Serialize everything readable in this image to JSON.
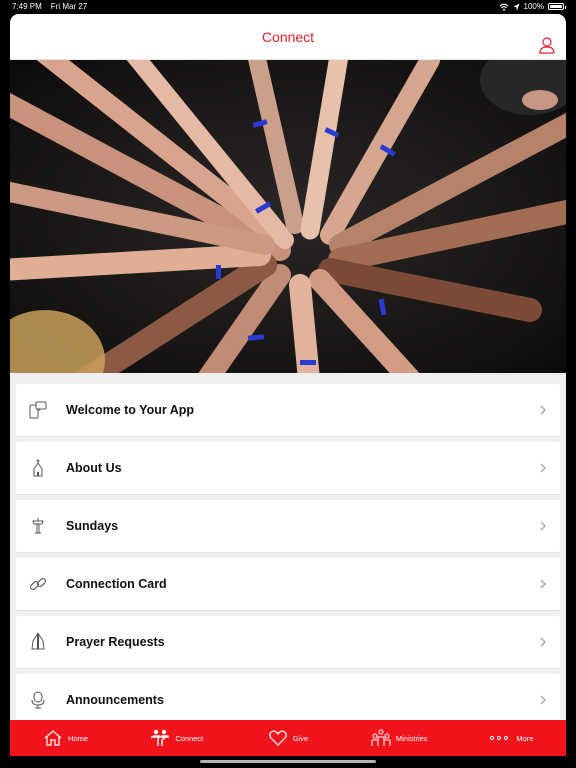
{
  "status": {
    "time": "7:49 PM",
    "date": "Fri Mar 27",
    "battery": "100%",
    "battery_level": 1.0
  },
  "header": {
    "title": "Connect",
    "profile_icon": "person-icon"
  },
  "hero": {
    "description_icon": "hands-together-photo"
  },
  "menu": [
    {
      "label": "Welcome to Your App",
      "icon": "devices-chat-icon"
    },
    {
      "label": "About Us",
      "icon": "church-icon"
    },
    {
      "label": "Sundays",
      "icon": "podium-icon"
    },
    {
      "label": "Connection Card",
      "icon": "link-icon"
    },
    {
      "label": "Prayer Requests",
      "icon": "praying-hands-icon"
    },
    {
      "label": "Announcements",
      "icon": "microphone-icon"
    }
  ],
  "tabs": [
    {
      "label": "Home",
      "icon": "home-icon"
    },
    {
      "label": "Connect",
      "icon": "people-connect-icon"
    },
    {
      "label": "Give",
      "icon": "heart-icon"
    },
    {
      "label": "Ministries",
      "icon": "group-icon"
    },
    {
      "label": "More",
      "icon": "more-dots-icon"
    }
  ],
  "colors": {
    "accent": "#e8212c",
    "tabbar": "#f2141d"
  }
}
